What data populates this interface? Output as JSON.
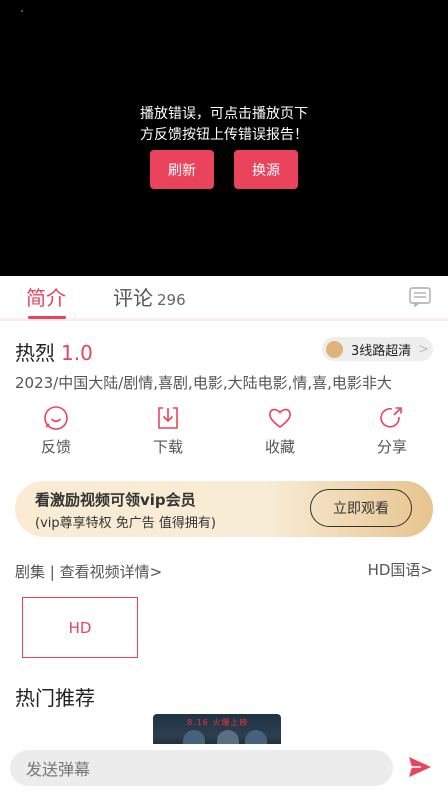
{
  "player": {
    "error_line1": "播放错误，可点击播放页下",
    "error_line2": "方反馈按钮上传错误报告！",
    "refresh_label": "刷新",
    "switch_label": "换源"
  },
  "tabs": {
    "intro_label": "简介",
    "comment_label": "评论",
    "comment_count": "296"
  },
  "video": {
    "title": "热烈",
    "score": "1.0",
    "line_label": "3线路超清",
    "meta": "2023/中国大陆/剧情,喜剧,电影,大陆电影,情,喜,电影非大"
  },
  "actions": [
    {
      "label": "反馈",
      "icon": "feedback-icon"
    },
    {
      "label": "下载",
      "icon": "download-icon"
    },
    {
      "label": "收藏",
      "icon": "heart-icon"
    },
    {
      "label": "分享",
      "icon": "share-icon"
    }
  ],
  "vip_banner": {
    "title": "看激励视频可领vip会员",
    "subtitle": "(vip尊享特权 免广告 值得拥有)",
    "button_label": "立即观看"
  },
  "episodes": {
    "label": "剧集 | 查看视频详情>",
    "source_label": "HD国语>",
    "items": [
      "HD"
    ]
  },
  "recommend": {
    "title": "热门推荐",
    "poster_text_a": "8.16",
    "poster_text_b": "火爆上映"
  },
  "danmaku": {
    "placeholder": "发送弹幕"
  },
  "colors": {
    "accent": "#e9445c",
    "player_bg": "#000000"
  }
}
